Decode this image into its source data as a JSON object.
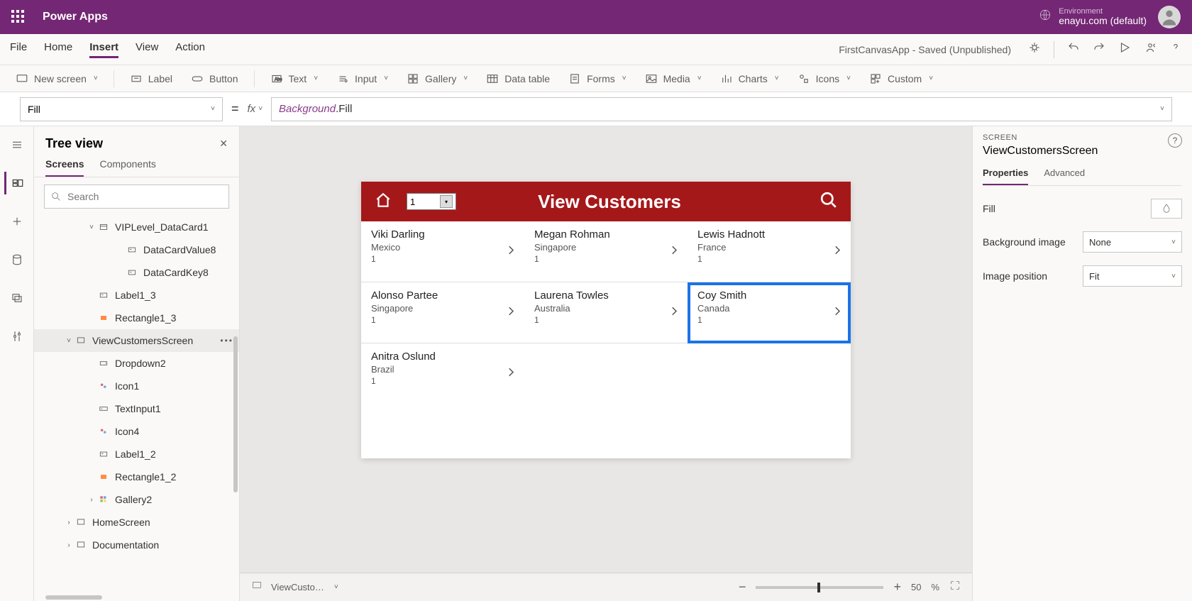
{
  "header": {
    "brand": "Power Apps",
    "env_label": "Environment",
    "env_value": "enayu.com (default)"
  },
  "menubar": {
    "items": [
      "File",
      "Home",
      "Insert",
      "View",
      "Action"
    ],
    "active_index": 2,
    "app_status": "FirstCanvasApp - Saved (Unpublished)"
  },
  "ribbon": {
    "new_screen": "New screen",
    "label": "Label",
    "button": "Button",
    "text": "Text",
    "input": "Input",
    "gallery": "Gallery",
    "data_table": "Data table",
    "forms": "Forms",
    "media": "Media",
    "charts": "Charts",
    "icons": "Icons",
    "custom": "Custom"
  },
  "formula": {
    "property": "Fill",
    "fx": "fx",
    "object": "Background",
    "prop": ".Fill"
  },
  "tree": {
    "title": "Tree view",
    "tabs": [
      "Screens",
      "Components"
    ],
    "active_tab": 0,
    "search_placeholder": "Search",
    "items": [
      {
        "label": "VIPLevel_DataCard1",
        "indent": 2,
        "chev": "˅",
        "icon": "datacard"
      },
      {
        "label": "DataCardValue8",
        "indent": 3,
        "icon": "textinput"
      },
      {
        "label": "DataCardKey8",
        "indent": 3,
        "icon": "textinput"
      },
      {
        "label": "Label1_3",
        "indent": 2,
        "icon": "textinput"
      },
      {
        "label": "Rectangle1_3",
        "indent": 2,
        "icon": "rect"
      },
      {
        "label": "ViewCustomersScreen",
        "indent": 1,
        "chev": "˅",
        "icon": "screen",
        "selected": true,
        "more": true
      },
      {
        "label": "Dropdown2",
        "indent": 2,
        "icon": "dropdown"
      },
      {
        "label": "Icon1",
        "indent": 2,
        "icon": "iconpair"
      },
      {
        "label": "TextInput1",
        "indent": 2,
        "icon": "textinput2"
      },
      {
        "label": "Icon4",
        "indent": 2,
        "icon": "iconpair"
      },
      {
        "label": "Label1_2",
        "indent": 2,
        "icon": "textinput"
      },
      {
        "label": "Rectangle1_2",
        "indent": 2,
        "icon": "rect"
      },
      {
        "label": "Gallery2",
        "indent": 2,
        "chev": "›",
        "icon": "gallery"
      },
      {
        "label": "HomeScreen",
        "indent": 1,
        "chev": "›",
        "icon": "screen"
      },
      {
        "label": "Documentation",
        "indent": 1,
        "chev": "›",
        "icon": "screen"
      }
    ]
  },
  "app": {
    "title": "View Customers",
    "dropdown_value": "1",
    "customers": [
      {
        "name": "Viki  Darling",
        "country": "Mexico",
        "num": "1"
      },
      {
        "name": "Megan  Rohman",
        "country": "Singapore",
        "num": "1"
      },
      {
        "name": "Lewis  Hadnott",
        "country": "France",
        "num": "1"
      },
      {
        "name": "Alonso  Partee",
        "country": "Singapore",
        "num": "1"
      },
      {
        "name": "Laurena  Towles",
        "country": "Australia",
        "num": "1"
      },
      {
        "name": "Coy  Smith",
        "country": "Canada",
        "num": "1",
        "selected": true
      },
      {
        "name": "Anitra  Oslund",
        "country": "Brazil",
        "num": "1",
        "last": true
      }
    ]
  },
  "breadcrumb": {
    "text": "ViewCusto…",
    "zoom": "50",
    "zoom_unit": "%"
  },
  "right_panel": {
    "label": "SCREEN",
    "title": "ViewCustomersScreen",
    "tabs": [
      "Properties",
      "Advanced"
    ],
    "active_tab": 0,
    "fill_label": "Fill",
    "bg_image_label": "Background image",
    "bg_image_value": "None",
    "img_pos_label": "Image position",
    "img_pos_value": "Fit"
  }
}
